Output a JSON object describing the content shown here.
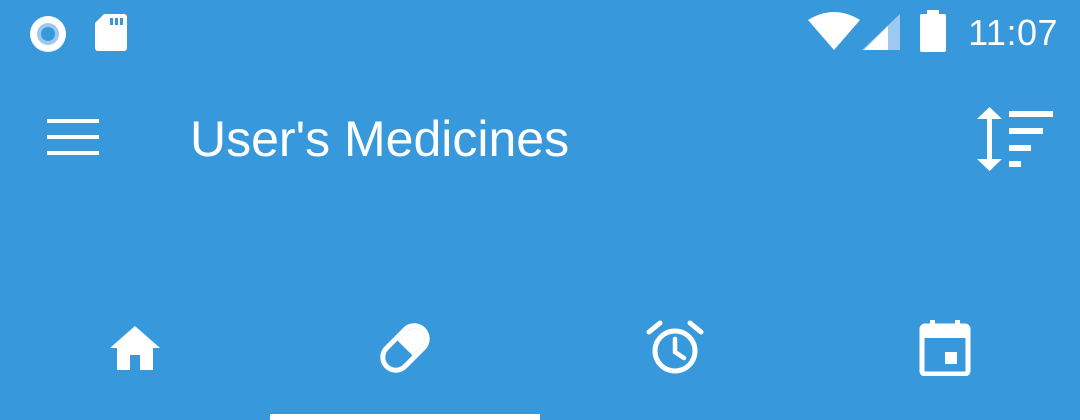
{
  "status_bar": {
    "time": "11:07",
    "icons": [
      "circle-notification-icon",
      "sd-card-icon",
      "wifi-icon",
      "cell-signal-icon",
      "battery-icon"
    ]
  },
  "toolbar": {
    "title": "User's Medicines",
    "menu_icon": "menu-icon",
    "sort_icon": "sort-icon"
  },
  "tabs": [
    {
      "icon": "home-icon",
      "selected": false
    },
    {
      "icon": "pill-icon",
      "selected": true
    },
    {
      "icon": "alarm-icon",
      "selected": false
    },
    {
      "icon": "calendar-icon",
      "selected": false
    }
  ],
  "colors": {
    "primary": "#3898DC",
    "on_primary": "#FFFFFF"
  }
}
